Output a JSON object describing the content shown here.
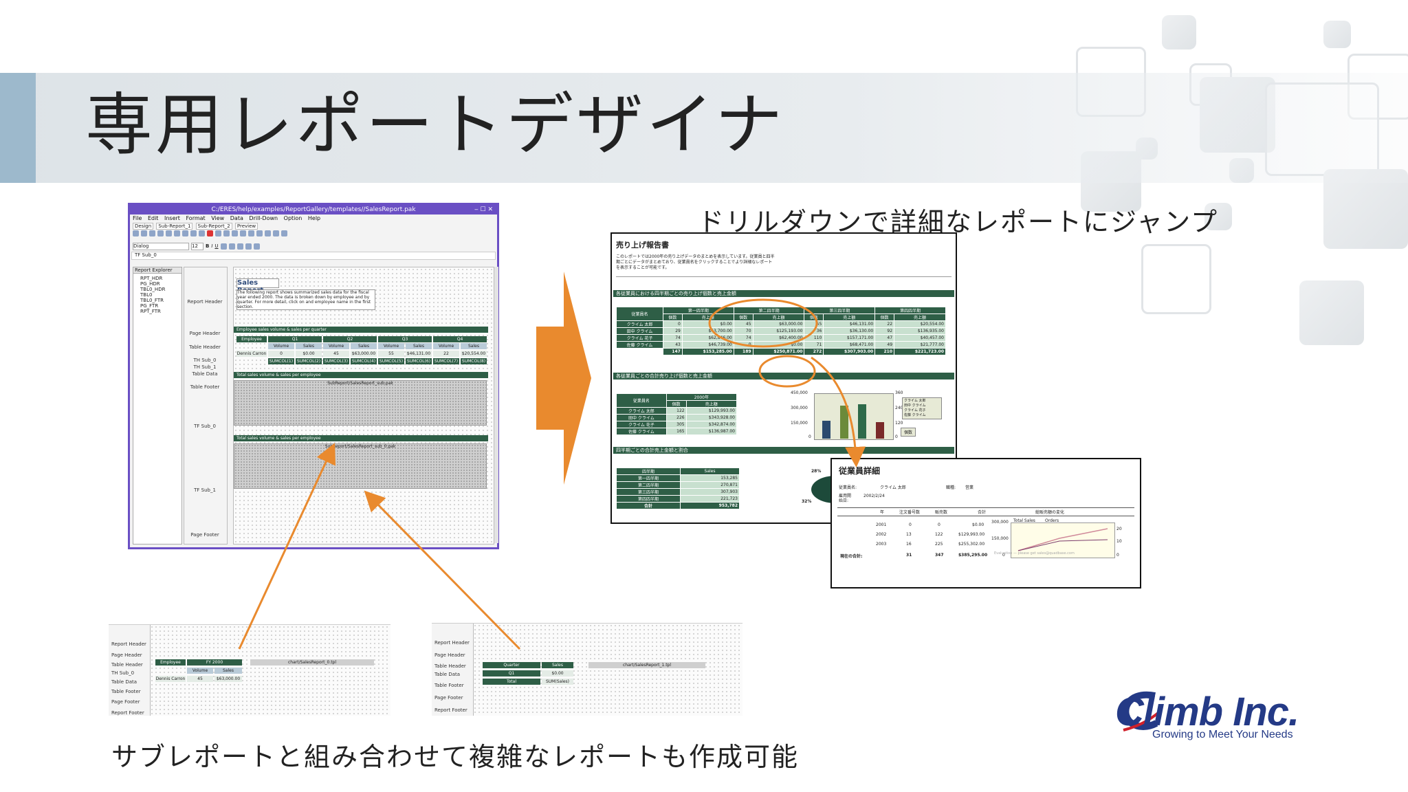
{
  "slide": {
    "title": "専用レポートデザイナ",
    "caption_top": "ドリルダウンで詳細なレポートにジャンプ",
    "caption_bottom": "サブレポートと組み合わせて複雑なレポートも作成可能"
  },
  "designer": {
    "window_title": "C:/ERES/help/examples/ReportGallery/templates//SalesReport.pak",
    "menu": [
      "File",
      "Edit",
      "Insert",
      "Format",
      "View",
      "Data",
      "Drill-Down",
      "Option",
      "Help"
    ],
    "tabs": [
      "Design",
      "Sub-Report_1",
      "Sub-Report_2",
      "Preview"
    ],
    "dialog_label": "Dialog",
    "font_size": "12",
    "selected_band": "TF Sub_0",
    "explorer_title": "Report Explorer",
    "explorer_items": [
      "RPT_HDR",
      "PG_HDR",
      "TBL0_HDR",
      "TBL0",
      "TBL0_FTR",
      "PG_FTR",
      "RPT_FTR"
    ],
    "bands": [
      "Report Header",
      "Page Header",
      "Table Header",
      "TH Sub_0",
      "TH Sub_1",
      "Table Data",
      "Table Footer",
      "TF Sub_0",
      "TF Sub_1",
      "Page Footer"
    ],
    "report_title": "Sales Report",
    "report_desc": "The following report shows summarized sales data for the fiscal year ended 2000. The data is broken down by employee and by quarter. For more detail, click on and employee name in the first section.",
    "section1": "Employee sales volume & sales per quarter",
    "header_cells": [
      "Employee",
      "Q1",
      "Q2",
      "Q3",
      "Q4"
    ],
    "sub_header_cells": [
      "Volume",
      "Sales",
      "Volume",
      "Sales",
      "Volume",
      "Sales",
      "Volume",
      "Sales"
    ],
    "data_row": [
      "Dennis Carron",
      "0",
      "$0.00",
      "45",
      "$63,000.00",
      "55",
      "$46,131.00",
      "22",
      "$20,554.00"
    ],
    "sum_cells": [
      "SUMCOL(1)",
      "SUMCOL(2)",
      "SUMCOL(3)",
      "SUMCOL(4)",
      "SUMCOL(5)",
      "SUMCOL(6)",
      "SUMCOL(7)",
      "SUMCOL(8)"
    ],
    "section2": "Total sales volume & sales per employee",
    "sub1": "SubReport/SalesReport_sub.pak",
    "section3": "Total sales volume & sales per employee",
    "sub2": "SubReport/SalesReport_sub_0.pak"
  },
  "preview": {
    "title": "売り上げ報告書",
    "desc": "このレポートでは2000年の売り上げデータのまとめを表示しています。従業員と四半期ごとにデータがまとめており、従業員名をクリックすることでより詳細なレポートを表示することが可能です。",
    "bar1": "各従業員における四半期ごとの売り上げ個数と売上金額",
    "col_name": "従業員名",
    "quarters": [
      "第一四半期",
      "第二四半期",
      "第三四半期",
      "第四四半期"
    ],
    "sub_cols": [
      "個数",
      "売上額"
    ],
    "rows": [
      {
        "name": "クライム 太郎",
        "v": [
          "0",
          "$0.00",
          "45",
          "$63,000.00",
          "55",
          "$46,131.00",
          "22",
          "$20,554.00"
        ]
      },
      {
        "name": "田中 クライム",
        "v": [
          "29",
          "$43,700.00",
          "70",
          "$125,193.00",
          "36",
          "$36,130.00",
          "92",
          "$136,935.00"
        ]
      },
      {
        "name": "クライム 花子",
        "v": [
          "74",
          "$62,846.00",
          "74",
          "$62,400.00",
          "110",
          "$157,171.00",
          "47",
          "$40,457.00"
        ]
      },
      {
        "name": "佐藤 クライム",
        "v": [
          "43",
          "$46,739.00",
          "0",
          "$0.00",
          "71",
          "$68,471.00",
          "49",
          "$21,777.00"
        ]
      }
    ],
    "total_row": [
      "147",
      "$153,285.00",
      "189",
      "$250,871.00",
      "272",
      "$307,903.00",
      "210",
      "$221,723.00"
    ],
    "bar2": "各従業員ごとの合計売り上げ個数と売上金額",
    "table2_year": "2000年",
    "table2_rows": [
      {
        "name": "クライム 太郎",
        "v": [
          "122",
          "$129,993.00"
        ]
      },
      {
        "name": "田中 クライム",
        "v": [
          "226",
          "$343,928.00"
        ]
      },
      {
        "name": "クライム 花子",
        "v": [
          "305",
          "$342,874.00"
        ]
      },
      {
        "name": "佐藤 クライム",
        "v": [
          "165",
          "$136,987.00"
        ]
      }
    ],
    "chart_yticks": [
      "450,000",
      "300,000",
      "150,000",
      "0"
    ],
    "chart_y2ticks": [
      "360",
      "240",
      "120",
      "0"
    ],
    "legend": [
      "クライム 太郎",
      "田中 クライム",
      "クライム 花子",
      "佐藤 クライム"
    ],
    "legend2": "個数",
    "bar3": "四半期ごとの合計売上金額と割合",
    "table3_head": [
      "四半期",
      "Sales"
    ],
    "table3_rows": [
      {
        "name": "第一四半期",
        "v": "153,285"
      },
      {
        "name": "第二四半期",
        "v": "270,871"
      },
      {
        "name": "第三四半期",
        "v": "307,903"
      },
      {
        "name": "第四四半期",
        "v": "221,723"
      },
      {
        "name": "合計",
        "v": "953,782"
      }
    ],
    "pie_labels": [
      "28%",
      "32%"
    ]
  },
  "detail": {
    "title": "従業員詳細",
    "name_label": "従業員名:",
    "name_value": "クライム 太郎",
    "role_label": "職種:",
    "role_value": "営業",
    "hire_label": "雇用開始日:",
    "hire_value": "2002/2/24",
    "cols": [
      "年",
      "注文番号数",
      "販売数",
      "合計",
      "総販売額の変化"
    ],
    "rows": [
      [
        "2001",
        "0",
        "0",
        "$0.00"
      ],
      [
        "2002",
        "13",
        "122",
        "$129,993.00"
      ],
      [
        "2003",
        "16",
        "225",
        "$255,302.00"
      ]
    ],
    "total_label": "現在の合計:",
    "total_row": [
      "31",
      "347",
      "$385,295.00"
    ],
    "legend": [
      "Total Sales",
      "Orders"
    ],
    "yticks": [
      "300,000",
      "150,000",
      "0"
    ],
    "y2ticks": [
      "20",
      "10",
      "0"
    ],
    "note": "Evaluation — please get sales@quadbase.com"
  },
  "snippet1": {
    "bands": [
      "Report Header",
      "Page Header",
      "Table Header",
      "TH Sub_0",
      "Table Data",
      "Table Footer",
      "Page Footer",
      "Report Footer"
    ],
    "cells": [
      "Employee",
      "FY 2000",
      "Volume",
      "Sales",
      "Dennis Carron",
      "45",
      "$63,000.00"
    ],
    "chart": "chart/SalesReport_0.tpl"
  },
  "snippet2": {
    "bands": [
      "Report Header",
      "Page Header",
      "Table Header",
      "Table Data",
      "Table Footer",
      "Page Footer",
      "Report Footer"
    ],
    "cells": [
      "Quarter",
      "Sales",
      "Q1",
      "$0.00",
      "Total",
      "SUM(Sales)"
    ],
    "chart": "chart/SalesReport_1.tpl"
  },
  "logo": {
    "name": "Climb Inc.",
    "tagline": "Growing to Meet Your Needs",
    "colors": {
      "primary": "#243a86",
      "accent": "#d0202a"
    }
  },
  "colors": {
    "arrow": "#e98a2e",
    "band": "#2e5e46",
    "title_accent": "#9db9cc"
  }
}
